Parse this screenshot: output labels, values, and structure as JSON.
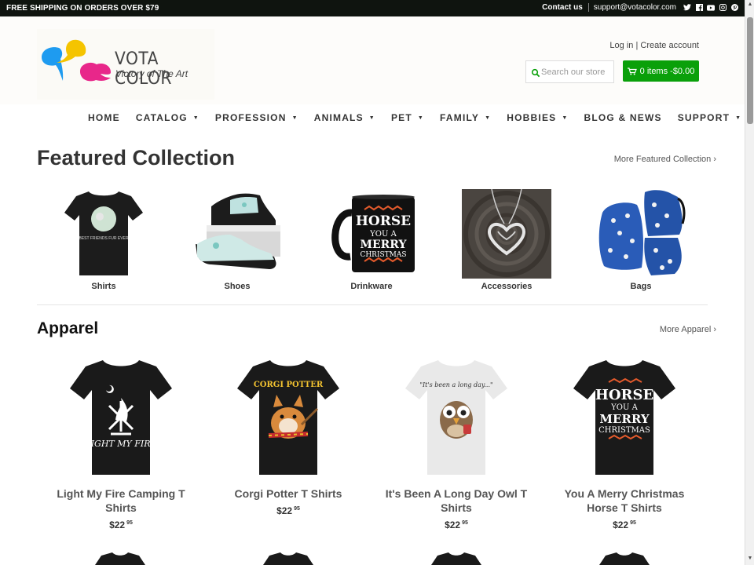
{
  "announcement": {
    "text": "FREE SHIPPING ON ORDERS OVER $79",
    "contact_label": "Contact us",
    "email": "support@votacolor.com",
    "social_icons": [
      "twitter-icon",
      "facebook-icon",
      "youtube-icon",
      "instagram-icon",
      "pinterest-icon"
    ]
  },
  "header": {
    "brand": "VOTA COLOR",
    "tagline": "Victory of The Art",
    "login_label": "Log in",
    "account_separator": "|",
    "create_account_label": "Create account",
    "search_placeholder": "Search our store",
    "cart_label": "0 items -$0.00"
  },
  "nav": {
    "items": [
      {
        "label": "HOME",
        "dropdown": false
      },
      {
        "label": "CATALOG",
        "dropdown": true
      },
      {
        "label": "PROFESSION",
        "dropdown": true
      },
      {
        "label": "ANIMALS",
        "dropdown": true
      },
      {
        "label": "PET",
        "dropdown": true
      },
      {
        "label": "FAMILY",
        "dropdown": true
      },
      {
        "label": "HOBBIES",
        "dropdown": true
      },
      {
        "label": "BLOG & NEWS",
        "dropdown": false
      },
      {
        "label": "SUPPORT",
        "dropdown": true
      }
    ]
  },
  "featured": {
    "title": "Featured Collection",
    "more_label": "More Featured Collection ›",
    "collections": [
      {
        "label": "Shirts"
      },
      {
        "label": "Shoes"
      },
      {
        "label": "Drinkware"
      },
      {
        "label": "Accessories"
      },
      {
        "label": "Bags"
      }
    ]
  },
  "apparel": {
    "title": "Apparel",
    "more_label": "More Apparel ›",
    "products": [
      {
        "title": "Light My Fire Camping T Shirts",
        "price": "$22",
        "cents": "95",
        "shirt_color": "#1a1a1a",
        "print_text": "LIGHT MY FIRE"
      },
      {
        "title": "Corgi Potter T Shirts",
        "price": "$22",
        "cents": "95",
        "shirt_color": "#1a1a1a",
        "print_text": "CORGI POTTER"
      },
      {
        "title": "It's Been A Long Day Owl T Shirts",
        "price": "$22",
        "cents": "95",
        "shirt_color": "#e8e8e8",
        "print_text": "It's been a long day..."
      },
      {
        "title": "You A Merry Christmas Horse T Shirts",
        "price": "$22",
        "cents": "95",
        "shirt_color": "#1a1a1a",
        "print_text": "HORSE YOU A MERRY CHRISTMAS"
      }
    ]
  },
  "mug_text": "HORSE YOU A MERRY CHRISTMAS",
  "colors": {
    "announcement_bg": "#0f140f",
    "cart_button": "#0aa00a",
    "logo_blue": "#1e9bf0",
    "logo_yellow": "#f5c400",
    "logo_pink": "#e8278a"
  }
}
